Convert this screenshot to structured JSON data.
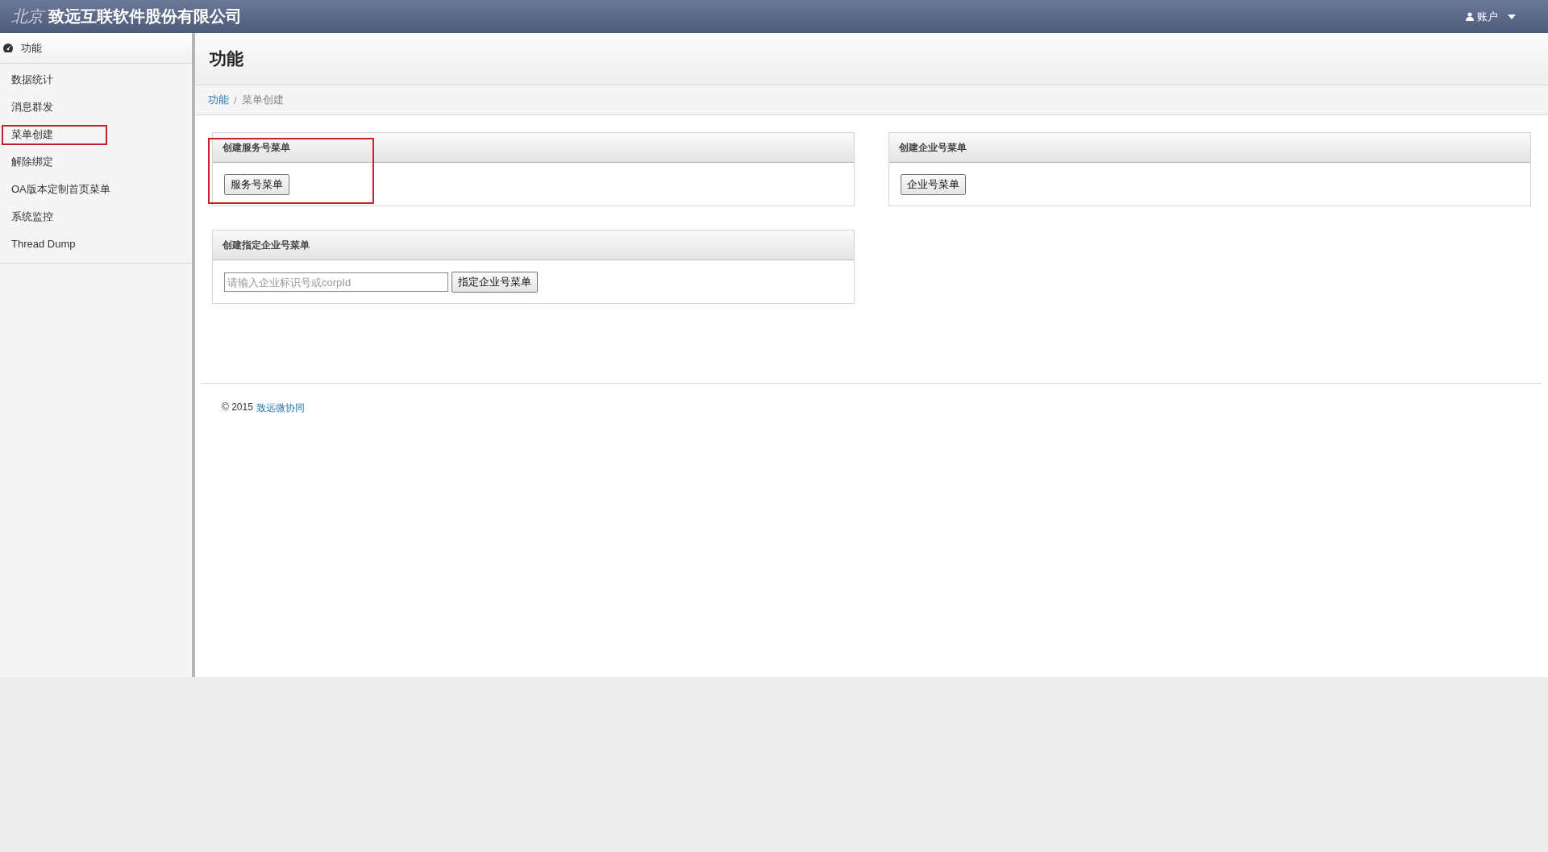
{
  "navbar": {
    "city": "北京",
    "brand": "致远互联软件股份有限公司",
    "account": "账户"
  },
  "sidebar": {
    "header": "功能",
    "items": [
      {
        "label": "数据统计",
        "selected": false
      },
      {
        "label": "消息群发",
        "selected": false
      },
      {
        "label": "菜单创建",
        "selected": true
      },
      {
        "label": "解除绑定",
        "selected": false
      },
      {
        "label": "OA版本定制首页菜单",
        "selected": false
      },
      {
        "label": "系统监控",
        "selected": false
      },
      {
        "label": "Thread Dump",
        "selected": false
      }
    ]
  },
  "page_title": "功能",
  "breadcrumb": [
    {
      "label": "功能",
      "kind": "link"
    },
    {
      "label": "/",
      "kind": "separator"
    },
    {
      "label": "菜单创建",
      "kind": "current"
    }
  ],
  "panels": [
    {
      "title": "创建服务号菜单",
      "highlighted": true,
      "button": "服务号菜单"
    },
    {
      "title": "创建企业号菜单",
      "highlighted": false,
      "button": "企业号菜单"
    },
    {
      "title": "创建指定企业号菜单",
      "highlighted": false,
      "placeholder": "请输入企业标识号或corpId",
      "button": "指定企业号菜单"
    }
  ],
  "footer": {
    "copyright": "© 2015",
    "link": "致远微协同"
  }
}
